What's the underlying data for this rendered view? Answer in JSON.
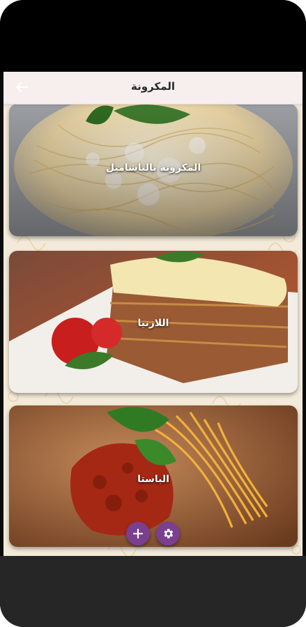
{
  "appbar": {
    "title": "المكرونة",
    "back_icon": "arrow-back-icon"
  },
  "recipes": [
    {
      "label": "المكرونة بالباشاميل",
      "image": "pasta-bechamel-photo"
    },
    {
      "label": "اللازنيا",
      "image": "lasagna-photo"
    },
    {
      "label": "الباستا",
      "image": "pasta-fork-photo"
    }
  ],
  "actions": {
    "add_icon": "plus-icon",
    "settings_icon": "gear-icon"
  },
  "colors": {
    "appbar_background": "#f7eeee",
    "fab_background": "#7a3f8f",
    "content_background": "#f3ead9"
  }
}
